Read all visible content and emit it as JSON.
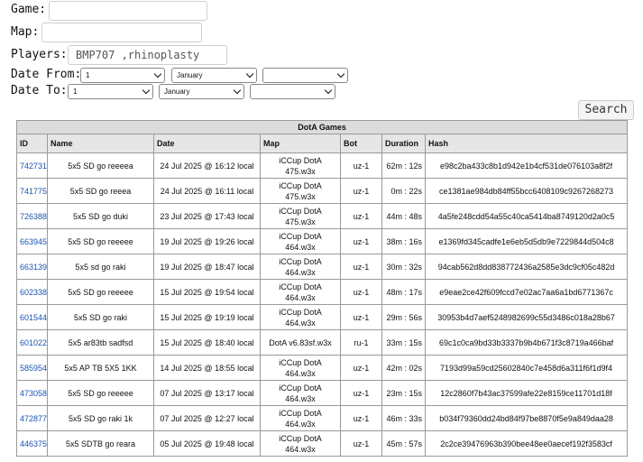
{
  "form": {
    "game_label": "Game:",
    "game_value": "",
    "map_label": "Map:",
    "map_value": "",
    "players_label": "Players:",
    "players_value": "BMP707 ,rhinoplasty",
    "date_from_label": "Date From:",
    "date_to_label": "Date To:",
    "from_day": "1",
    "from_month": "January",
    "from_year": "",
    "to_day": "1",
    "to_month": "January",
    "to_year": "",
    "search_label": "Search"
  },
  "table": {
    "caption": "DotA Games",
    "headers": [
      "ID",
      "Name",
      "Date",
      "Map",
      "Bot",
      "Duration",
      "Hash"
    ],
    "rows": [
      {
        "id": "742731",
        "name": "5x5 SD go reeeea",
        "date": "24 Jul 2025 @ 16:12 local",
        "map": "iCCup DotA 475.w3x",
        "bot": "uz-1",
        "duration": "62m : 12s",
        "hash": "e98c2ba433c8b1d942e1b4cf531de076103a8f2f"
      },
      {
        "id": "741775",
        "name": "5x5 SD go reeea",
        "date": "24 Jul 2025 @ 16:11 local",
        "map": "iCCup DotA 475.w3x",
        "bot": "uz-1",
        "duration": "0m : 22s",
        "hash": "ce1381ae984db84ff55bcc6408109c9267268273"
      },
      {
        "id": "726388",
        "name": "5x5 SD go duki",
        "date": "23 Jul 2025 @ 17:43 local",
        "map": "iCCup DotA 475.w3x",
        "bot": "uz-1",
        "duration": "44m : 48s",
        "hash": "4a5fe248cdd54a55c40ca5414ba8749120d2a0c5"
      },
      {
        "id": "663945",
        "name": "5x5 SD go reeeee",
        "date": "19 Jul 2025 @ 19:26 local",
        "map": "iCCup DotA 464.w3x",
        "bot": "uz-1",
        "duration": "38m : 16s",
        "hash": "e1369fd345cadfe1e6eb5d5db9e7229844d504c8"
      },
      {
        "id": "663139",
        "name": "5x5 sd go raki",
        "date": "19 Jul 2025 @ 18:47 local",
        "map": "iCCup DotA 464.w3x",
        "bot": "uz-1",
        "duration": "30m : 32s",
        "hash": "94cab562d8dd838772436a2585e3dc9cf05c482d"
      },
      {
        "id": "602338",
        "name": "5x5 SD go reeeee",
        "date": "15 Jul 2025 @ 19:54 local",
        "map": "iCCup DotA 464.w3x",
        "bot": "uz-1",
        "duration": "48m : 17s",
        "hash": "e9eae2ce42f609fccd7e02ac7aa6a1bd6771367c"
      },
      {
        "id": "601544",
        "name": "5x5 SD go raki",
        "date": "15 Jul 2025 @ 19:19 local",
        "map": "iCCup DotA 464.w3x",
        "bot": "uz-1",
        "duration": "29m : 56s",
        "hash": "30953b4d7aef5248982699c55d3486c018a28b67"
      },
      {
        "id": "601022",
        "name": "5x5 ar83tb sadfsd",
        "date": "15 Jul 2025 @ 18:40 local",
        "map": "DotA v6.83sf.w3x",
        "bot": "ru-1",
        "duration": "33m : 15s",
        "hash": "69c1c0ca9bd33b3337b9b4b671f3c8719a466baf"
      },
      {
        "id": "585954",
        "name": "5x5 AP TB 5X5 1KK",
        "date": "14 Jul 2025 @ 18:55 local",
        "map": "iCCup DotA 464.w3x",
        "bot": "uz-1",
        "duration": "42m : 02s",
        "hash": "7193d99a59cd25602840c7e458d6a311f6f1d9f4"
      },
      {
        "id": "473058",
        "name": "5x5 SD go reeeee",
        "date": "07 Jul 2025 @ 13:17 local",
        "map": "iCCup DotA 464.w3x",
        "bot": "uz-1",
        "duration": "23m : 15s",
        "hash": "12c2860f7b43ac37599afe22e8159ce11701d18f"
      },
      {
        "id": "472877",
        "name": "5x5 SD go raki 1k",
        "date": "07 Jul 2025 @ 12:27 local",
        "map": "iCCup DotA 464.w3x",
        "bot": "uz-1",
        "duration": "46m : 33s",
        "hash": "b034f79360dd24bd84f97be8870f5e9a849daa28"
      },
      {
        "id": "446375",
        "name": "5x5 SDTB go reara",
        "date": "05 Jul 2025 @ 19:48 local",
        "map": "iCCup DotA 464.w3x",
        "bot": "uz-1",
        "duration": "45m : 57s",
        "hash": "2c2ce39476963b390bee48ee0aecef192f3583cf"
      }
    ]
  }
}
